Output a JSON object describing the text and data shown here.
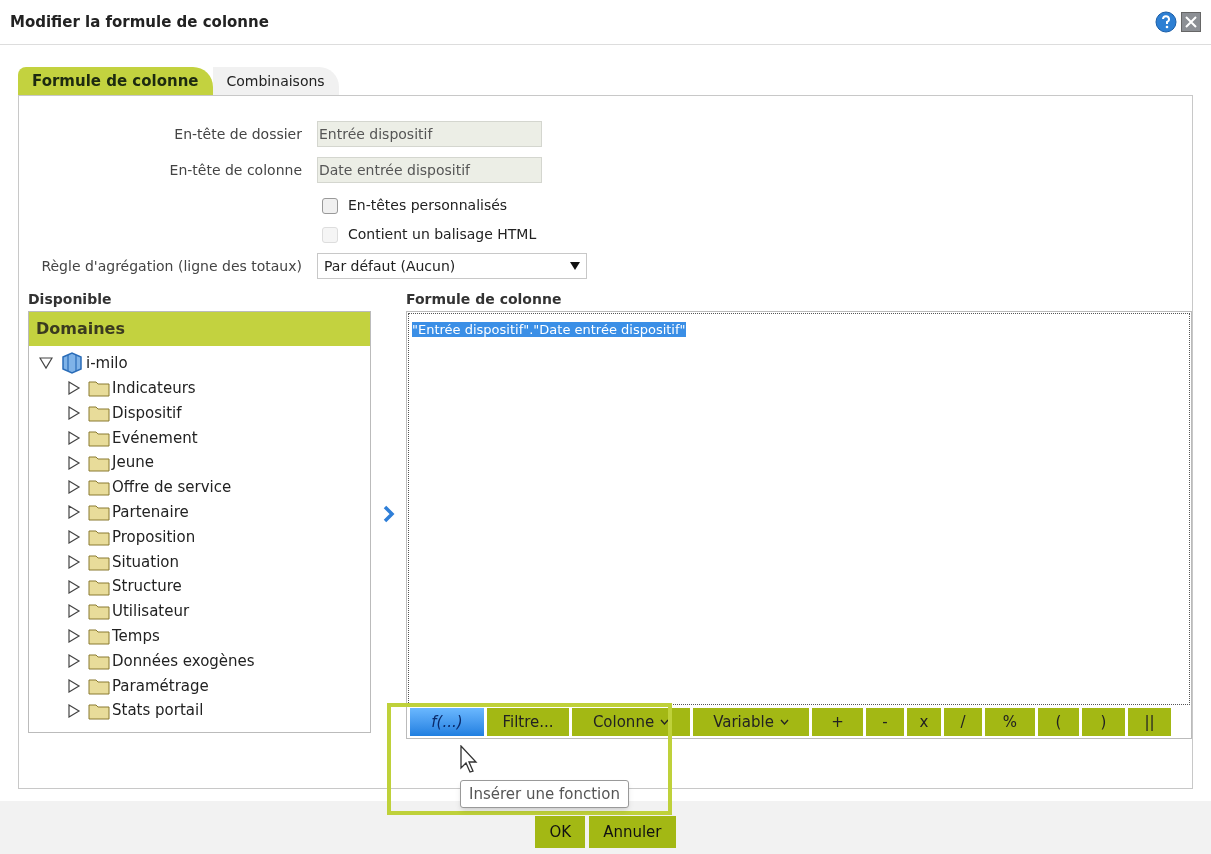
{
  "window": {
    "title": "Modifier la formule de colonne"
  },
  "tabs": [
    {
      "label": "Formule de colonne",
      "selected": true
    },
    {
      "label": "Combinaisons",
      "selected": false
    }
  ],
  "fields": [
    {
      "label": "En-tête de dossier",
      "value": "Entrée dispositif"
    },
    {
      "label": "En-tête de colonne",
      "value": "Date entrée dispositif"
    }
  ],
  "checkboxes": [
    {
      "label": "En-têtes personnalisés",
      "checked": false,
      "disabled": false
    },
    {
      "label": "Contient un balisage HTML",
      "checked": false,
      "disabled": true
    }
  ],
  "aggregation": {
    "label": "Règle d'agrégation (ligne des totaux)",
    "value": "Par défaut (Aucun)"
  },
  "available": {
    "title": "Disponible",
    "header": "Domaines",
    "tree": [
      {
        "label": "i-milo",
        "kind": "subject",
        "expanded": true,
        "children": [
          {
            "label": "Indicateurs",
            "kind": "folder",
            "expanded": false
          },
          {
            "label": "Dispositif",
            "kind": "folder",
            "expanded": false
          },
          {
            "label": "Evénement",
            "kind": "folder",
            "expanded": false
          },
          {
            "label": "Jeune",
            "kind": "folder",
            "expanded": false
          },
          {
            "label": "Offre de service",
            "kind": "folder",
            "expanded": false
          },
          {
            "label": "Partenaire",
            "kind": "folder",
            "expanded": false
          },
          {
            "label": "Proposition",
            "kind": "folder",
            "expanded": false
          },
          {
            "label": "Situation",
            "kind": "folder",
            "expanded": false
          },
          {
            "label": "Structure",
            "kind": "folder",
            "expanded": false
          },
          {
            "label": "Utilisateur",
            "kind": "folder",
            "expanded": false
          },
          {
            "label": "Temps",
            "kind": "folder",
            "expanded": false
          },
          {
            "label": "Données exogènes",
            "kind": "folder",
            "expanded": false
          },
          {
            "label": "Paramétrage",
            "kind": "folder",
            "expanded": false
          },
          {
            "label": "Stats portail",
            "kind": "folder",
            "expanded": false
          }
        ]
      }
    ]
  },
  "formula": {
    "title": "Formule de colonne",
    "value": "\"Entrée dispositif\".\"Date entrée dispositif\"",
    "toolbar": [
      {
        "label": "f(...)",
        "highlighted": true,
        "dropdown": false
      },
      {
        "label": "Filtre...",
        "highlighted": false,
        "dropdown": false
      },
      {
        "label": "Colonne",
        "highlighted": false,
        "dropdown": true
      },
      {
        "label": "Variable",
        "highlighted": false,
        "dropdown": true
      },
      {
        "label": "+",
        "highlighted": false,
        "dropdown": false
      },
      {
        "label": "-",
        "highlighted": false,
        "dropdown": false
      },
      {
        "label": "x",
        "highlighted": false,
        "dropdown": false
      },
      {
        "label": "/",
        "highlighted": false,
        "dropdown": false
      },
      {
        "label": "%",
        "highlighted": false,
        "dropdown": false
      },
      {
        "label": "(",
        "highlighted": false,
        "dropdown": false
      },
      {
        "label": ")",
        "highlighted": false,
        "dropdown": false
      },
      {
        "label": "||",
        "highlighted": false,
        "dropdown": false
      }
    ]
  },
  "tooltip": "Insérer une fonction",
  "footer_buttons": [
    "OK",
    "Annuler"
  ]
}
